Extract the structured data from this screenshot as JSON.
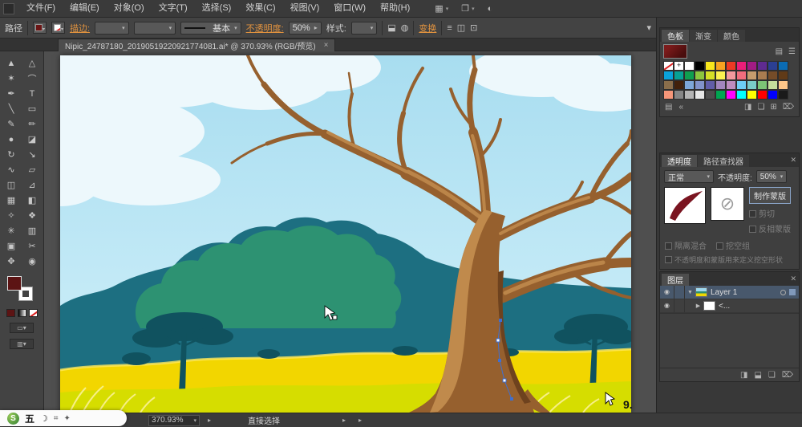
{
  "menubar": {
    "items": [
      "文件(F)",
      "编辑(E)",
      "对象(O)",
      "文字(T)",
      "选择(S)",
      "效果(C)",
      "视图(V)",
      "窗口(W)",
      "帮助(H)"
    ]
  },
  "control_bar": {
    "context_label": "路径",
    "stroke_link": "描边:",
    "brush_definition": "基本",
    "opacity_label": "不透明度:",
    "opacity_value": "50%",
    "style_label": "样式:",
    "transform_link": "变换"
  },
  "document_tab": {
    "title": "Nipic_24787180_20190519220921774081.ai* @ 370.93% (RGB/预览)",
    "close_glyph": "×"
  },
  "toolbar": {
    "tools": [
      {
        "name": "selection-tool",
        "glyph": "▲"
      },
      {
        "name": "direct-selection-tool",
        "glyph": "△"
      },
      {
        "name": "magic-wand-tool",
        "glyph": "✶"
      },
      {
        "name": "lasso-tool",
        "glyph": "⌒"
      },
      {
        "name": "pen-tool",
        "glyph": "✒"
      },
      {
        "name": "type-tool",
        "glyph": "T"
      },
      {
        "name": "line-segment-tool",
        "glyph": "╲"
      },
      {
        "name": "rectangle-tool",
        "glyph": "▭"
      },
      {
        "name": "paintbrush-tool",
        "glyph": "✎"
      },
      {
        "name": "pencil-tool",
        "glyph": "✏"
      },
      {
        "name": "blob-brush-tool",
        "glyph": "●"
      },
      {
        "name": "eraser-tool",
        "glyph": "◪"
      },
      {
        "name": "rotate-tool",
        "glyph": "↻"
      },
      {
        "name": "scale-tool",
        "glyph": "↘"
      },
      {
        "name": "width-tool",
        "glyph": "∿"
      },
      {
        "name": "free-transform-tool",
        "glyph": "▱"
      },
      {
        "name": "shape-builder-tool",
        "glyph": "◫"
      },
      {
        "name": "perspective-grid-tool",
        "glyph": "⊿"
      },
      {
        "name": "mesh-tool",
        "glyph": "▦"
      },
      {
        "name": "gradient-tool",
        "glyph": "◧"
      },
      {
        "name": "eyedropper-tool",
        "glyph": "✧"
      },
      {
        "name": "blend-tool",
        "glyph": "❖"
      },
      {
        "name": "symbol-sprayer-tool",
        "glyph": "✳"
      },
      {
        "name": "column-graph-tool",
        "glyph": "▥"
      },
      {
        "name": "artboard-tool",
        "glyph": "▣"
      },
      {
        "name": "slice-tool",
        "glyph": "✂"
      },
      {
        "name": "hand-tool",
        "glyph": "✥"
      },
      {
        "name": "zoom-tool",
        "glyph": "◉"
      }
    ]
  },
  "panels": {
    "swatches": {
      "tabs": [
        "色板",
        "渐变",
        "颜色"
      ],
      "colors": [
        "none",
        "reg",
        "#ffffff",
        "#000000",
        "#f7e61c",
        "#f7a321",
        "#ee3a24",
        "#ec1e79",
        "#a21c84",
        "#5f2b90",
        "#2b3f93",
        "#0b6cb5",
        "#0aa3dc",
        "#07a295",
        "#0f9f4f",
        "#8cc63e",
        "#d5df26",
        "#fcf151",
        "#f5989d",
        "#f26d7d",
        "#c69c6d",
        "#a97c50",
        "#754c28",
        "#603a17",
        "#8a6e4b",
        "#42210b",
        "#7da7d9",
        "#8293ca",
        "#615da8",
        "#a286be",
        "#bd8cbf",
        "#6dcff6",
        "#7accc8",
        "#7cc576",
        "#c4df9b",
        "#fdc689",
        "#f69679",
        "#858585",
        "#b3b3b3",
        "#e6e6e6",
        "#4d4d4d",
        "#00a651",
        "#ff00ff",
        "#00ffff",
        "#ffff00",
        "#ff0000",
        "#0000ff",
        "#1a1a1a"
      ]
    },
    "transparency": {
      "tabs": [
        "透明度",
        "路径查找器"
      ],
      "blend_mode": "正常",
      "opacity_label": "不透明度:",
      "opacity_value": "50%",
      "make_mask_button": "制作蒙版",
      "clip_label": "剪切",
      "invert_mask_label": "反相蒙版",
      "isolate_label": "隔离混合",
      "knockout_label": "挖空组",
      "define_label": "不透明度和蒙版用来定义挖空形状"
    },
    "layers": {
      "tab": "图层",
      "rows": [
        {
          "name": "Layer 1"
        },
        {
          "name": "<..."
        }
      ]
    }
  },
  "status_bar": {
    "zoom": "370.93%",
    "tool_label": "直接选择"
  },
  "ime_bar": {
    "brand": "S",
    "mode": "五",
    "moon": "☽"
  },
  "canvas": {
    "annotation": "9.",
    "colors": {
      "sky": "#aadcf0",
      "cloud": "#edf8fc",
      "bush_teal": "#1d6f81",
      "bush_green": "#2d9272",
      "tree_silhouette": "#10525f",
      "grass_yellow": "#f2d600",
      "grass_shadow": "#d6dd00",
      "grass_light": "#f7ef86",
      "trunk_brown": "#96602e",
      "trunk_highlight": "#c08a4c",
      "trunk_dark": "#6e421e",
      "anchor_blue": "#3f6fd0"
    }
  }
}
